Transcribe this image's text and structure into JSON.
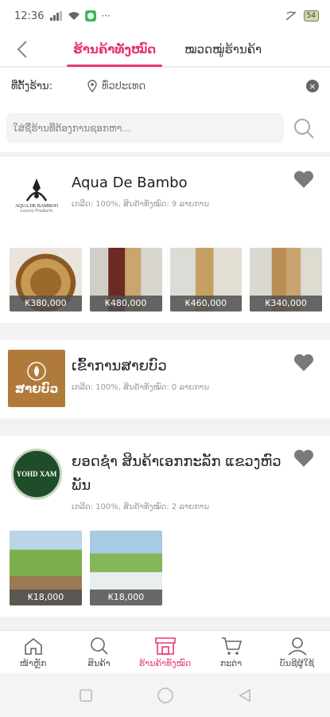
{
  "status_bar": {
    "time": "12:36",
    "battery": "54"
  },
  "header": {
    "tabs": [
      {
        "label": "ຮ້ານຄ້າທັງໝົດ"
      },
      {
        "label": "ໝວດໝູ່ຮ້ານຄ້າ"
      }
    ]
  },
  "location": {
    "label": "ທີ່ຕັ້ງຮ້ານ:",
    "value": "ທົ່ວປະເທດ"
  },
  "search": {
    "placeholder": "ໃສ່ຊື່ຮ້ານທີ່ຕ້ອງການຊອກຫາ..."
  },
  "shops": [
    {
      "name": "Aqua De Bambo",
      "logo_text": "AQUA DE BAMBOO",
      "logo_sub": "Luxury Products",
      "meta": "ເກລີດ: 100%, ສິນຄ້າທັງໝົດ: 9 ລາຍການ",
      "products": [
        {
          "price": "₭380,000"
        },
        {
          "price": "₭480,000"
        },
        {
          "price": "₭460,000"
        },
        {
          "price": "₭340,000"
        }
      ]
    },
    {
      "name": "ເຂົ້າການສາຍບົວ",
      "logo_text": "ສາຍບົວ",
      "meta": "ເກລີດ: 100%, ສິນຄ້າທັງໝົດ: 0 ລາຍການ",
      "products": []
    },
    {
      "name": "ຍອດຊໍາ ສິນຄ້າເອກກະລັກ ແຂວງຫົວພັນ",
      "logo_text": "YOHD XAM",
      "meta": "ເກລີດ: 100%, ສິນຄ້າທັງໝົດ: 2 ລາຍການ",
      "products": [
        {
          "price": "₭18,000"
        },
        {
          "price": "₭18,000"
        }
      ]
    }
  ],
  "tabbar": [
    {
      "label": "ໜ້າຫຼັກ",
      "icon": "home-icon"
    },
    {
      "label": "ສິນຄ້າ",
      "icon": "search-icon"
    },
    {
      "label": "ຮ້ານຄ້າທັງໝົດ",
      "icon": "store-icon"
    },
    {
      "label": "ກະຕ່າ",
      "icon": "cart-icon"
    },
    {
      "label": "ບັນຊີຜູ້ໃຊ້",
      "icon": "user-icon"
    }
  ],
  "colors": {
    "accent": "#e8386d",
    "heart": "#7a7a7a",
    "logo_green": "#1f4d2a",
    "logo_brown": "#b07a3a"
  }
}
